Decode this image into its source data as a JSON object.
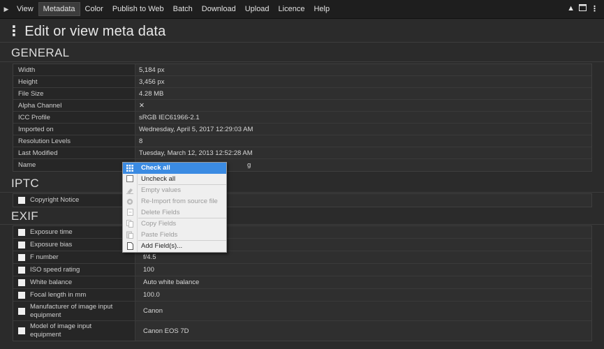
{
  "menubar": {
    "items": [
      "View",
      "Metadata",
      "Color",
      "Publish to Web",
      "Batch",
      "Download",
      "Upload",
      "Licence",
      "Help"
    ],
    "active_index": 1,
    "play_icon": "play-icon",
    "right_icons": [
      "triangle-up-icon",
      "window-icon",
      "kebab-icon"
    ]
  },
  "page_title": "Edit or view meta data",
  "general": {
    "heading": "GENERAL",
    "rows": [
      {
        "key": "Width",
        "value": "5,184 px"
      },
      {
        "key": "Height",
        "value": "3,456 px"
      },
      {
        "key": "File Size",
        "value": "4.28 MB"
      },
      {
        "key": "Alpha Channel",
        "value": "✕"
      },
      {
        "key": "ICC Profile",
        "value": "sRGB IEC61966-2.1"
      },
      {
        "key": "Imported on",
        "value": "Wednesday, April 5, 2017 12:29:03 AM"
      },
      {
        "key": "Resolution Levels",
        "value": "8"
      },
      {
        "key": "Last Modified",
        "value": "Tuesday, March 12, 2013 12:52:28 AM"
      },
      {
        "key": "Name",
        "value": "g"
      }
    ]
  },
  "iptc": {
    "heading": "IPTC",
    "rows": [
      {
        "key": "Copyright Notice",
        "value": ""
      }
    ]
  },
  "exif": {
    "heading": "EXIF",
    "rows": [
      {
        "key": "Exposure time",
        "value": ""
      },
      {
        "key": "Exposure bias",
        "value": ""
      },
      {
        "key": "F number",
        "value": "f/4.5"
      },
      {
        "key": "ISO speed rating",
        "value": "100"
      },
      {
        "key": "White balance",
        "value": "Auto white balance"
      },
      {
        "key": "Focal length in mm",
        "value": "100.0"
      },
      {
        "key": "Manufacturer of image input equipment",
        "value": "Canon"
      },
      {
        "key": "Model of image input equipment",
        "value": "Canon EOS 7D"
      }
    ]
  },
  "context_menu": {
    "items": [
      {
        "label": "Check all",
        "icon": "grid-icon",
        "state": "selected"
      },
      {
        "label": "Uncheck all",
        "icon": "empty-box-icon",
        "state": "enabled"
      },
      {
        "label": "Empty values",
        "icon": "eraser-icon",
        "state": "disabled"
      },
      {
        "label": "Re-Import from source file",
        "icon": "reimport-icon",
        "state": "disabled"
      },
      {
        "label": "Delete Fields",
        "icon": "delete-fields-icon",
        "state": "disabled"
      },
      {
        "label": "Copy Fields",
        "icon": "copy-icon",
        "state": "disabled"
      },
      {
        "label": "Paste Fields",
        "icon": "paste-icon",
        "state": "disabled"
      },
      {
        "label": "Add Field(s)...",
        "icon": "new-document-icon",
        "state": "enabled"
      }
    ]
  },
  "colors": {
    "background": "#2b2b2b",
    "menubar": "#1e1e1e",
    "selection": "#3b8be2",
    "context_menu_bg": "#efefef"
  }
}
